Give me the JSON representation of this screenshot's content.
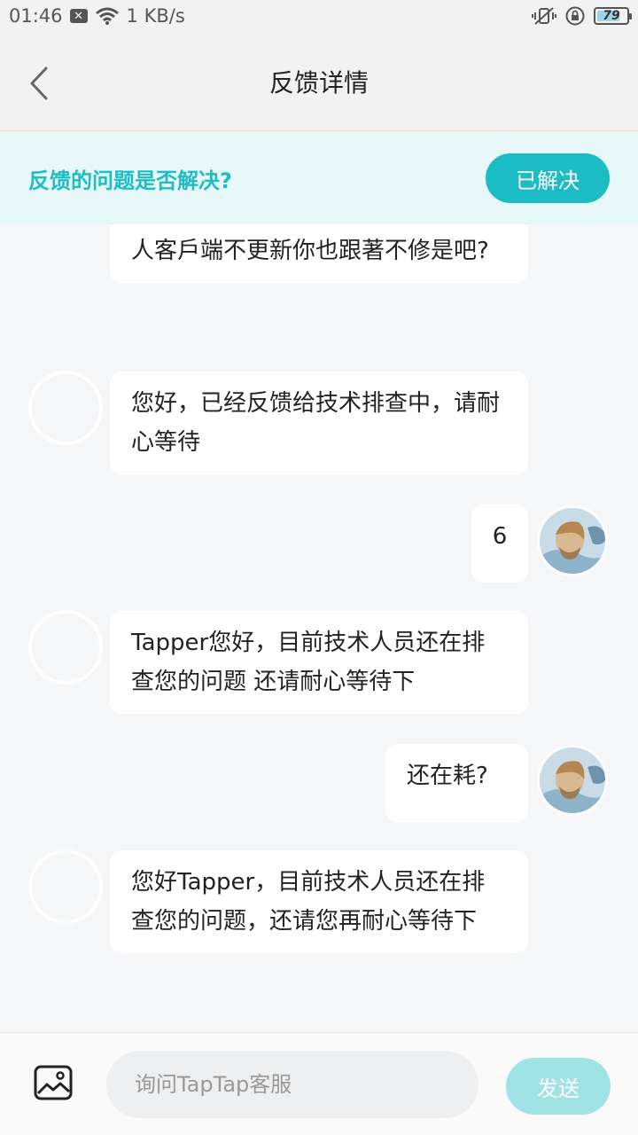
{
  "status_bar": {
    "time": "01:46",
    "notification_icon": "x-notification-icon",
    "net_speed": "1 KB/s",
    "battery": "79",
    "battery_level": 0.79
  },
  "header": {
    "title": "反馈详情",
    "back_icon": "chevron-left-icon"
  },
  "banner": {
    "question": "反馈的问题是否解决?",
    "resolved_label": "已解决",
    "accent": "#1cbcc4"
  },
  "messages": [
    {
      "sender": "support",
      "text": "人客戶端不更新你也跟著不修是吧?"
    },
    {
      "sender": "support",
      "text": "您好，已经反馈给技术排查中，请耐心等待"
    },
    {
      "sender": "user",
      "text": "6"
    },
    {
      "sender": "support",
      "text": "Tapper您好，目前技术人员还在排查您的问题 还请耐心等待下"
    },
    {
      "sender": "user",
      "text": "还在耗?"
    },
    {
      "sender": "support",
      "text": "您好Tapper，目前技术人员还在排查您的问题，还请您再耐心等待下"
    }
  ],
  "composer": {
    "image_icon": "image-icon",
    "placeholder": "询问TapTap客服",
    "send_label": "发送"
  }
}
